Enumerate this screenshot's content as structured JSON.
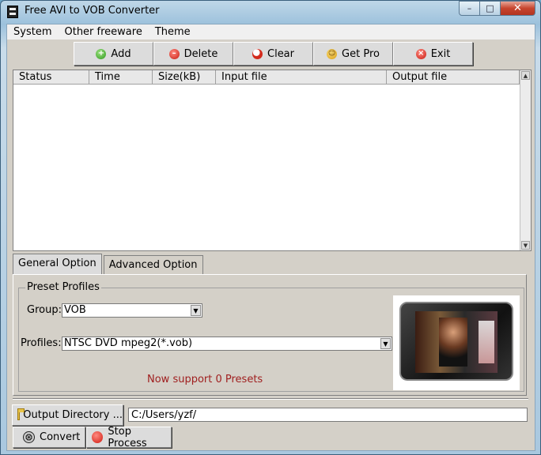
{
  "window": {
    "title": "Free AVI to VOB Converter"
  },
  "menu": [
    "System",
    "Other freeware",
    "Theme"
  ],
  "toolbar": {
    "add": "Add",
    "delete": "Delete",
    "clear": "Clear",
    "getpro": "Get Pro",
    "exit": "Exit"
  },
  "filelist": {
    "columns": [
      "Status",
      "Time",
      "Size(kB)",
      "Input file",
      "Output file"
    ],
    "rows": []
  },
  "tabs": [
    "General Option",
    "Advanced Option"
  ],
  "preset": {
    "group_title": "Preset Profiles",
    "group_label": "Group:",
    "group_value": "VOB",
    "profiles_label": "Profiles:",
    "profiles_value": "NTSC DVD mpeg2(*.vob)",
    "support_text": "Now support 0 Presets"
  },
  "output": {
    "dir_button": "Output Directory ...",
    "path": "C:/Users/yzf/"
  },
  "actions": {
    "convert": "Convert",
    "stop": "Stop Process"
  },
  "icons": [
    "app-icon",
    "add-icon",
    "delete-icon",
    "clear-icon",
    "get-pro-icon",
    "exit-icon",
    "folder-icon",
    "convert-icon",
    "stop-icon"
  ]
}
